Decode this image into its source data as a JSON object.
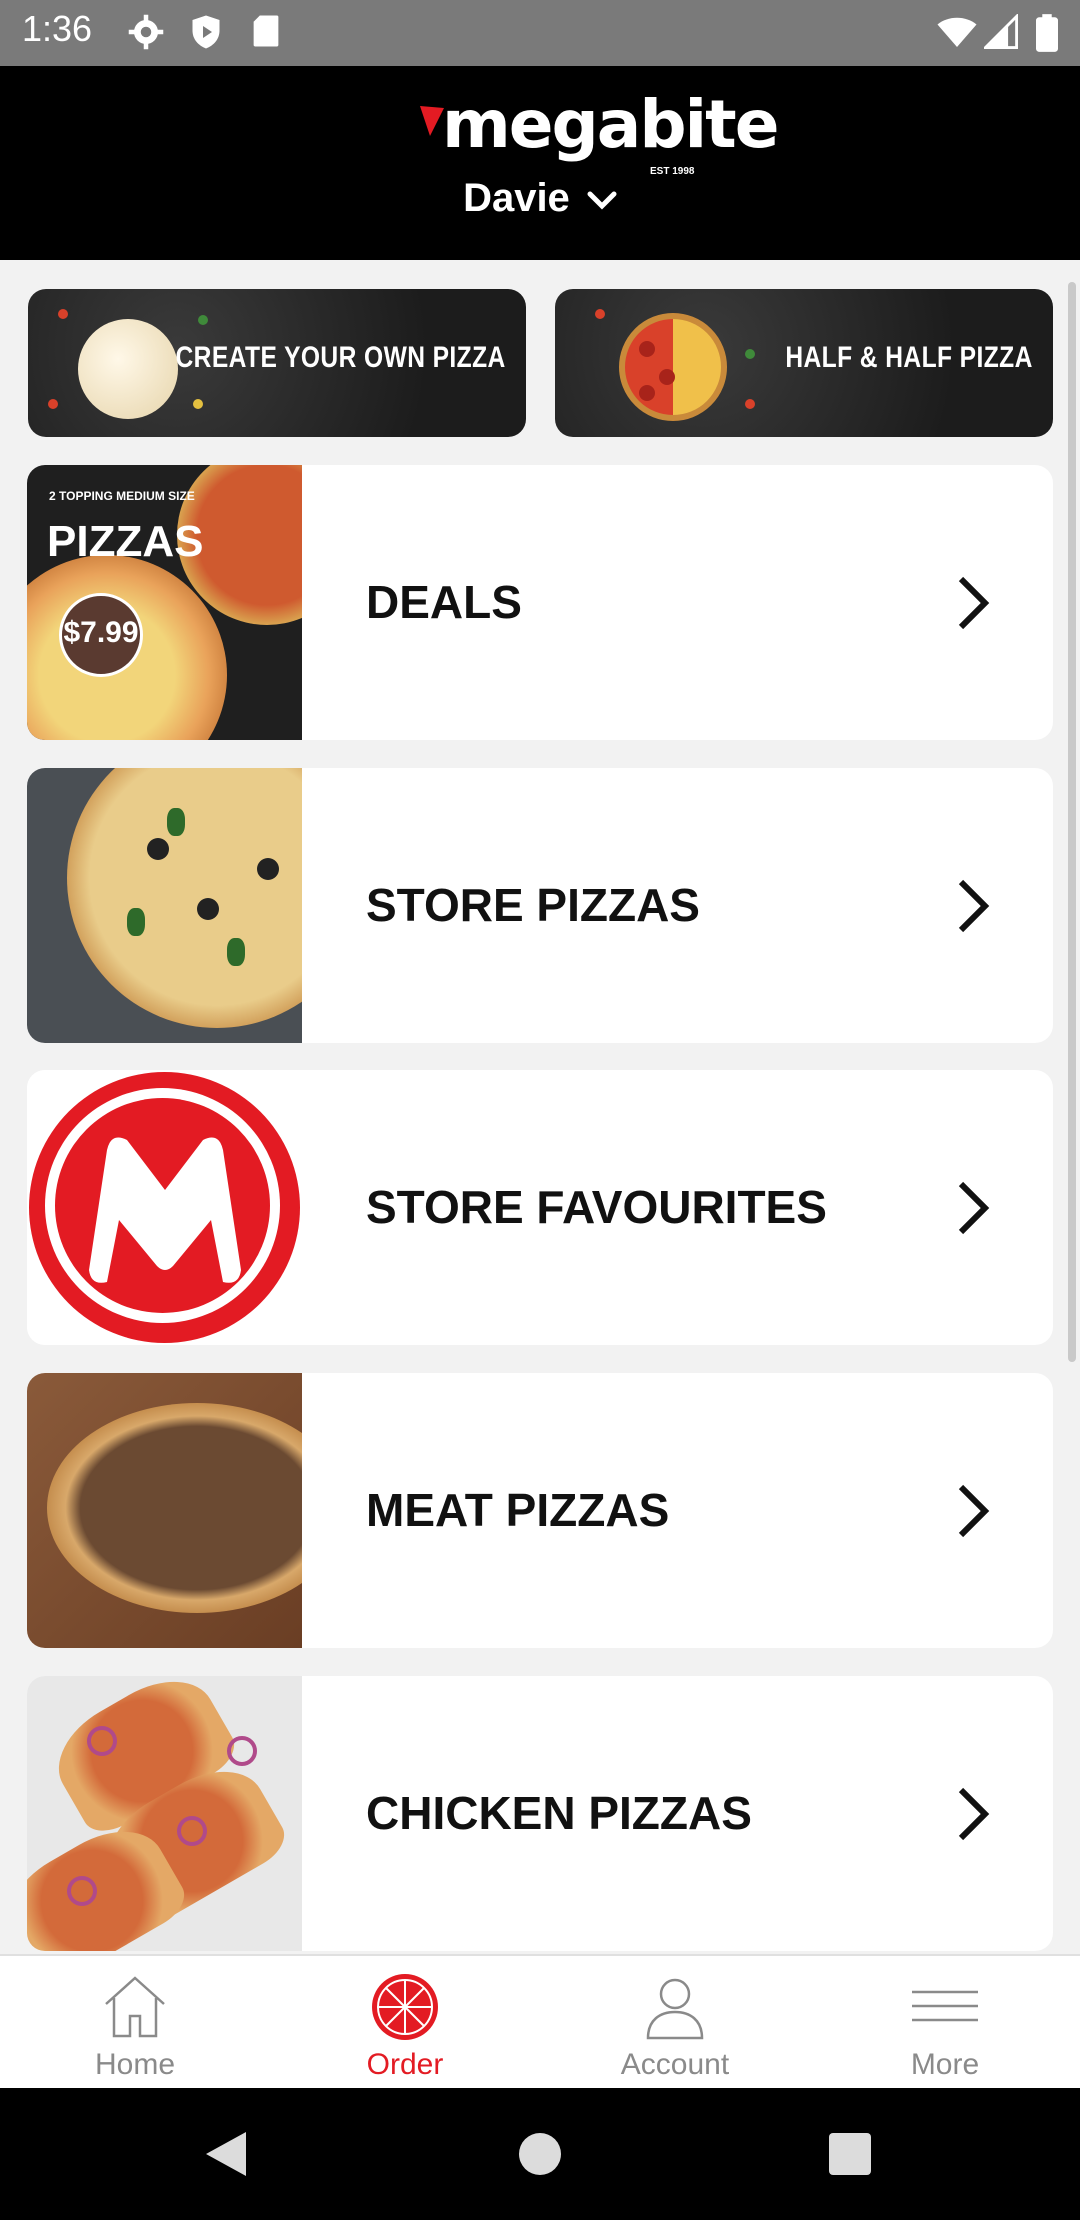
{
  "status_bar": {
    "time": "1:36",
    "icons": [
      "settings-icon",
      "shield-icon",
      "sd-card-icon",
      "wifi-icon",
      "signal-icon",
      "battery-icon"
    ]
  },
  "header": {
    "logo_text": "megabite",
    "logo_est": "EST 1998",
    "store_name": "Davie",
    "accent_color": "#e31b23"
  },
  "banners": [
    {
      "label": "CREATE YOUR OWN PIZZA"
    },
    {
      "label": "HALF & HALF PIZZA"
    }
  ],
  "deals_thumb": {
    "line1": "2 TOPPING MEDIUM SIZE",
    "line2": "PIZZAS",
    "price": "$7.99"
  },
  "categories": [
    {
      "label": "DEALS"
    },
    {
      "label": "STORE PIZZAS"
    },
    {
      "label": "STORE FAVOURITES"
    },
    {
      "label": "MEAT PIZZAS"
    },
    {
      "label": "CHICKEN PIZZAS"
    }
  ],
  "bottom_nav": [
    {
      "label": "Home",
      "icon": "home-icon",
      "active": false
    },
    {
      "label": "Order",
      "icon": "pizza-icon",
      "active": true
    },
    {
      "label": "Account",
      "icon": "person-icon",
      "active": false
    },
    {
      "label": "More",
      "icon": "menu-icon",
      "active": false
    }
  ]
}
